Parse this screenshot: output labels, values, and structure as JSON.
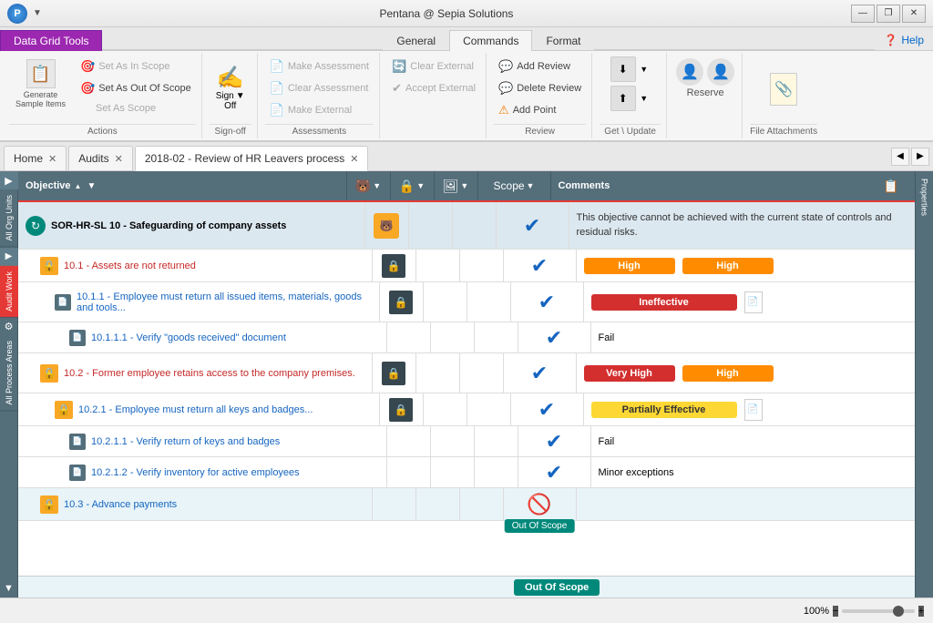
{
  "titleBar": {
    "title": "Pentana @ Sepia Solutions",
    "appIconText": "P",
    "windowControls": [
      "—",
      "❐",
      "✕"
    ]
  },
  "ribbon": {
    "tabs": [
      {
        "label": "General",
        "active": false
      },
      {
        "label": "Commands",
        "active": true
      },
      {
        "label": "Format",
        "active": false
      },
      {
        "label": "Data Grid Tools",
        "active": false,
        "special": "purple"
      }
    ],
    "helpLabel": "Help",
    "groups": {
      "actions1": {
        "label": "Actions",
        "generateLabel": "Generate\nSample Items",
        "setInScope": "Set As In Scope",
        "setOutOfScope": "Set As Out Of Scope",
        "setAsScope": "Set As Scope"
      },
      "signOff": {
        "label": "Sign-off",
        "signOffLabel": "Sign\nOff"
      },
      "actions2": {
        "label": "Actions",
        "makeAssessment": "Make Assessment",
        "clearAssessment": "Clear Assessment",
        "makeExternal": "Make External",
        "clearExternal": "Clear External",
        "acceptExternal": "Accept External"
      },
      "assessments": {
        "label": "Assessments"
      },
      "review": {
        "label": "Review",
        "addReview": "Add Review",
        "deleteReview": "Delete Review",
        "addPoint": "Add Point"
      },
      "getUpdate": {
        "label": "Get \\ Update"
      },
      "fileAttachments": {
        "label": "File Attachments"
      }
    }
  },
  "tabs": [
    {
      "label": "Home",
      "closeable": true
    },
    {
      "label": "Audits",
      "closeable": true
    },
    {
      "label": "2018-02 - Review of HR Leavers process",
      "closeable": true,
      "active": true
    }
  ],
  "leftSidebar": {
    "allOrgUnits": "All Org Units",
    "auditWork": "Audit Work",
    "allProcessAreas": "All Process Areas"
  },
  "grid": {
    "headers": [
      "Objective",
      "",
      "",
      "",
      "Scope",
      "Comments"
    ],
    "rows": [
      {
        "indent": 0,
        "iconType": "teal-spinner",
        "objText": "SOR-HR-SL 10 - Safeguarding of company assets",
        "icon1": "bear",
        "icon2": "",
        "icon3": "",
        "scopeIcon": "check-blue",
        "comment": "This objective cannot be achieved with the current state of controls and residual risks.",
        "hasFile": false,
        "isHeader": true
      },
      {
        "indent": 1,
        "iconType": "gold-lock",
        "objText": "10.1 - Assets are not returned",
        "objColor": "red",
        "icon1": "lock-img",
        "icon2": "",
        "icon3": "",
        "scopeIcon": "check-blue",
        "badge1": "High",
        "badge1Color": "orange",
        "badge2": "High",
        "badge2Color": "orange",
        "hasFile": false
      },
      {
        "indent": 2,
        "iconType": "blue-doc",
        "objText": "10.1.1 - Employee must return all issued items, materials, goods and tools...",
        "objColor": "blue",
        "icon1": "lock-img",
        "scopeIcon": "check-blue",
        "badge1": "Ineffective",
        "badge1Color": "red",
        "badge1Wide": true,
        "hasFile": true
      },
      {
        "indent": 3,
        "iconType": "blue-doc",
        "objText": "10.1.1.1 - Verify \"goods received\" document",
        "objColor": "blue",
        "scopeIcon": "check-blue",
        "comment": "Fail",
        "hasFile": false
      },
      {
        "indent": 1,
        "iconType": "gold-lock",
        "objText": "10.2 - Former employee retains access to the company premises.",
        "objColor": "red",
        "icon1": "lock-img",
        "scopeIcon": "check-blue",
        "badge1": "Very High",
        "badge1Color": "red",
        "badge2": "High",
        "badge2Color": "orange",
        "hasFile": false
      },
      {
        "indent": 2,
        "iconType": "gold-lock",
        "objText": "10.2.1 - Employee must return all keys and badges...",
        "objColor": "blue",
        "icon1": "lock-img",
        "scopeIcon": "check-blue",
        "badge1": "Partially Effective",
        "badge1Color": "yellow",
        "badge1Wide": true,
        "hasFile": true
      },
      {
        "indent": 3,
        "iconType": "blue-doc",
        "objText": "10.2.1.1 - Verify return of keys and badges",
        "objColor": "blue",
        "scopeIcon": "check-blue",
        "comment": "Fail",
        "hasFile": false
      },
      {
        "indent": 3,
        "iconType": "blue-doc",
        "objText": "10.2.1.2 - Verify inventory for active employees",
        "objColor": "blue",
        "scopeIcon": "check-blue",
        "comment": "Minor exceptions",
        "hasFile": false
      },
      {
        "indent": 1,
        "iconType": "gold-lock",
        "objText": "10.3 - Advance payments",
        "objColor": "blue",
        "scopeIcon": "scope-orange",
        "outOfScope": true,
        "hasFile": false
      }
    ]
  },
  "statusBar": {
    "zoomLevel": "100%",
    "outOfScopeLabel": "Out Of Scope"
  },
  "rightSidebar": {
    "label": "Properties"
  }
}
